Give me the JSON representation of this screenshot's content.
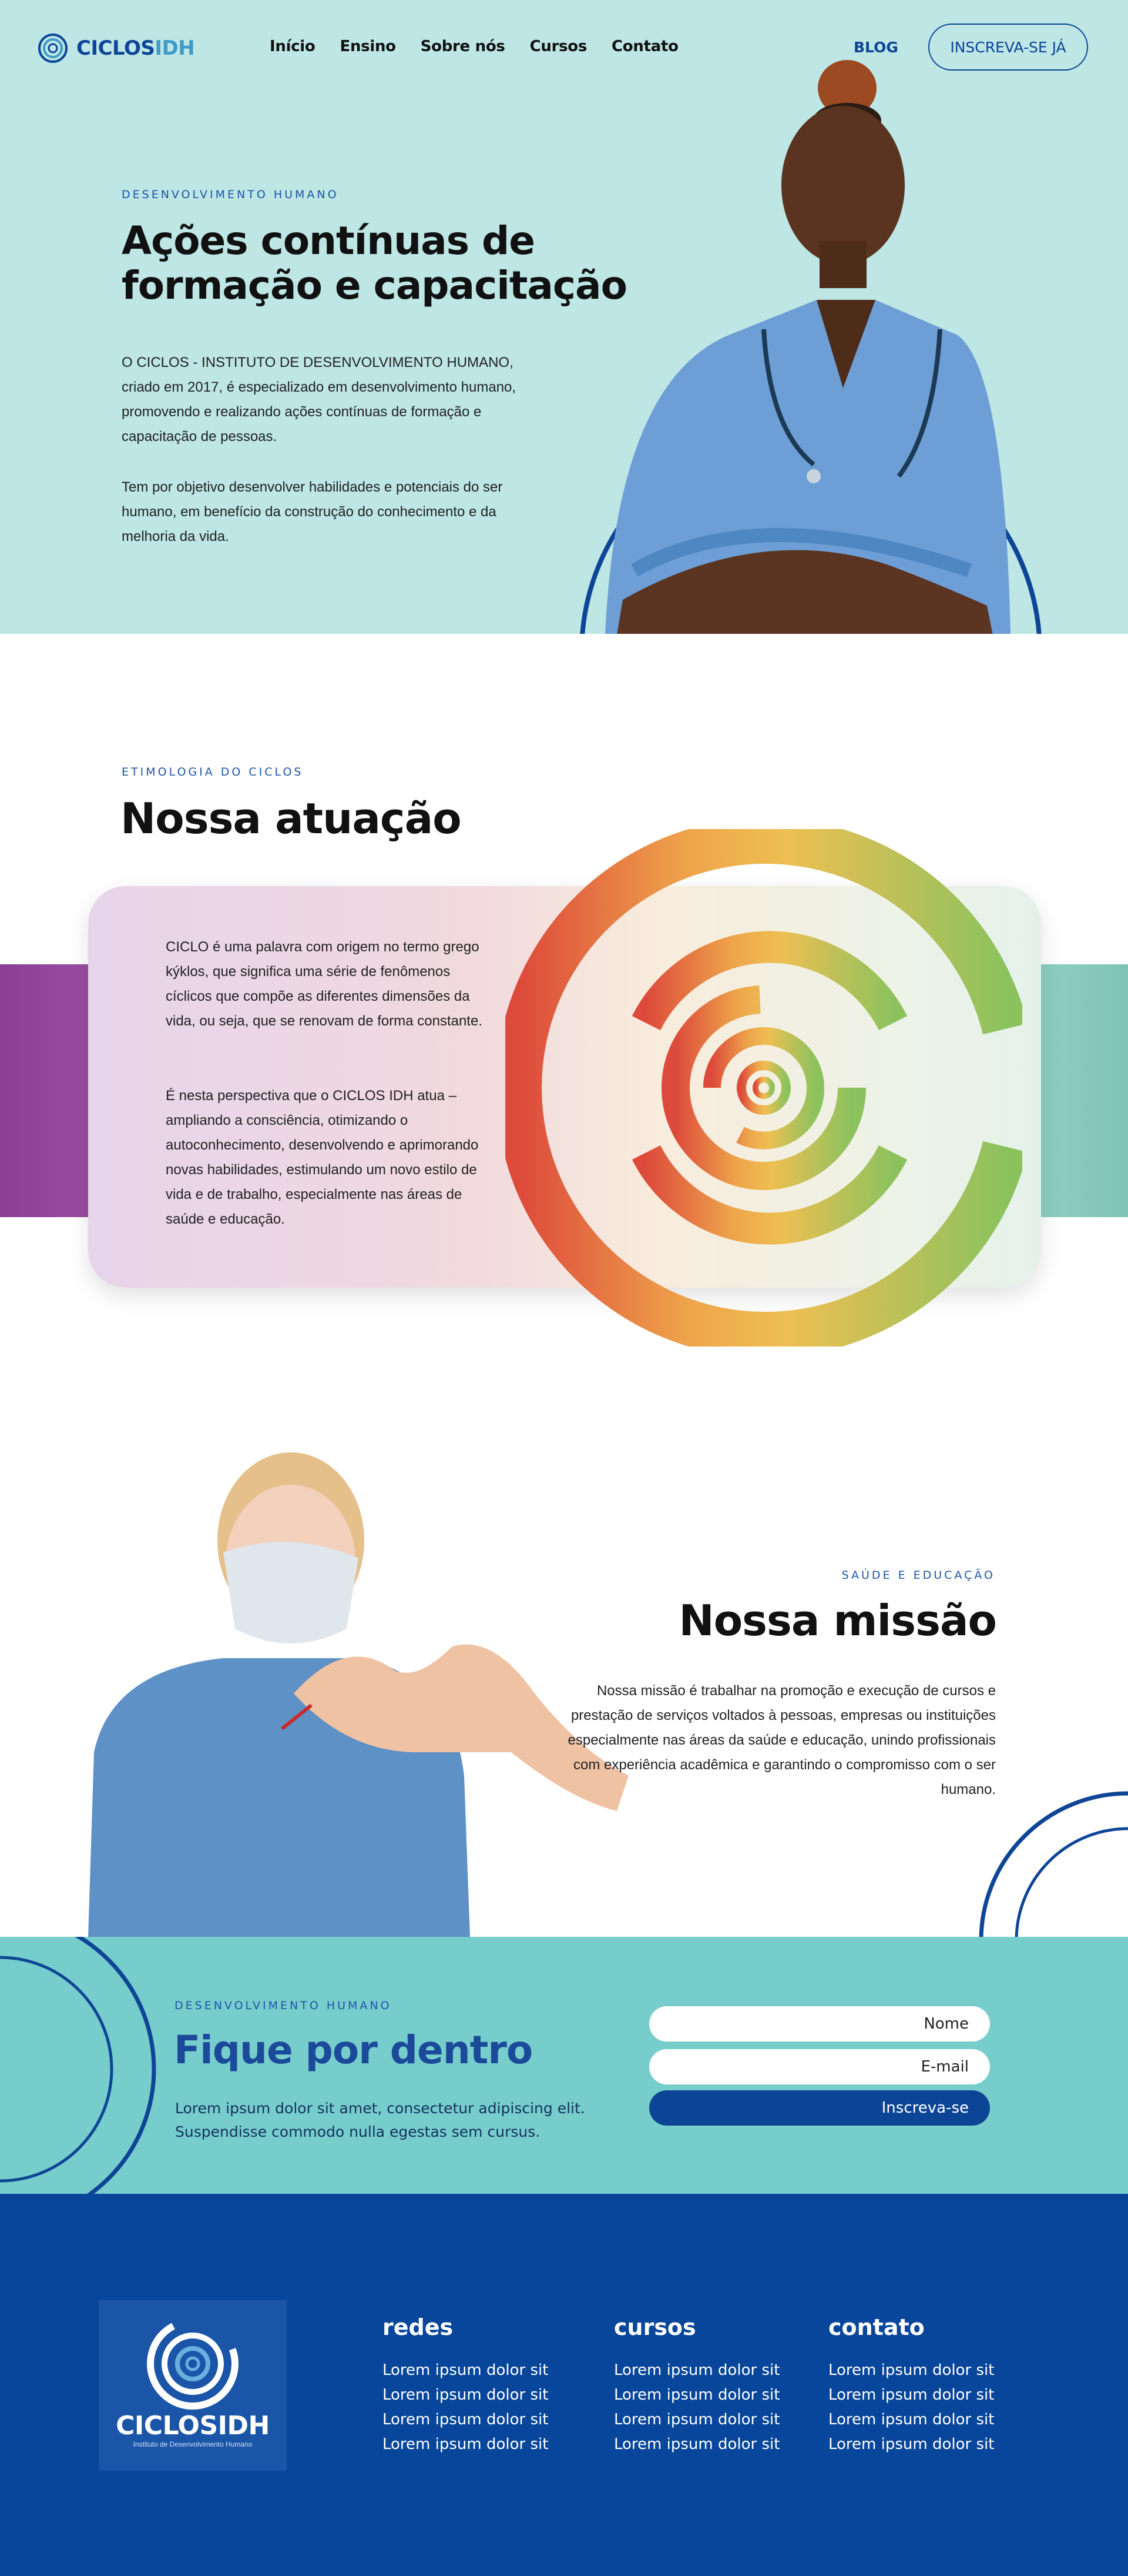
{
  "header": {
    "brand_main": "CICLOS",
    "brand_accent": "IDH",
    "nav": [
      "Início",
      "Ensino",
      "Sobre nós",
      "Cursos",
      "Contato"
    ],
    "blog": "BLOG",
    "cta": "INSCREVA-SE JÁ"
  },
  "hero": {
    "eyebrow": "DESENVOLVIMENTO HUMANO",
    "title": "Ações contínuas de formação e capacitação",
    "paragraph1": "O CICLOS - INSTITUTO DE DESENVOLVIMENTO HUMANO, criado em 2017, é especializado em desenvolvimento humano, promovendo e realizando ações contínuas de formação e capacitação de pessoas.",
    "paragraph2": "Tem por objetivo desenvolver habilidades e potenciais do ser humano, em benefício da construção do conhecimento e da melhoria da vida."
  },
  "atuacao": {
    "eyebrow": "ETIMOLOGIA DO CICLOS",
    "title": "Nossa atuação",
    "paragraph1": "CICLO é uma palavra com origem no termo grego kýklos, que significa uma série de fenômenos cíclicos que compõe as diferentes dimensões da vida, ou seja, que se renovam de forma constante.",
    "paragraph2": "É nesta perspectiva que o CICLOS IDH  atua – ampliando a consciência, otimizando o autoconhecimento, desenvolvendo e aprimorando novas habilidades, estimulando um novo estilo de vida e de trabalho, especialmente nas áreas de saúde e educação."
  },
  "missao": {
    "eyebrow": "SAÚDE E EDUCAÇÃO",
    "title": "Nossa missão",
    "paragraph": "Nossa missão é trabalhar na promoção e execução de cursos e prestação de serviços voltados à pessoas, empresas ou instituições especialmente nas áreas da saúde e educação, unindo profissionais com experiência acadêmica e garantindo o compromisso com o ser humano."
  },
  "newsletter": {
    "eyebrow": "DESENVOLVIMENTO HUMANO",
    "title": "Fique por dentro",
    "text": "Lorem ipsum dolor sit amet, consectetur adipiscing elit. Suspendisse commodo nulla egestas sem cursus.",
    "name_placeholder": "Nome",
    "email_placeholder": "E-mail",
    "button": "Inscreva-se"
  },
  "footer": {
    "brand": "CICLOSIDH",
    "brand_sub": "Instituto de Desenvolvimento Humano",
    "columns": [
      {
        "title": "redes",
        "items": [
          "Lorem ipsum dolor sit",
          "Lorem ipsum dolor sit",
          "Lorem ipsum dolor sit",
          "Lorem ipsum dolor sit"
        ]
      },
      {
        "title": "cursos",
        "items": [
          "Lorem ipsum dolor sit",
          "Lorem ipsum dolor sit",
          "Lorem ipsum dolor sit",
          "Lorem ipsum dolor sit"
        ]
      },
      {
        "title": "contato",
        "items": [
          "Lorem ipsum dolor sit",
          "Lorem ipsum dolor sit",
          "Lorem ipsum dolor sit",
          "Lorem ipsum dolor sit"
        ]
      }
    ]
  },
  "colors": {
    "hero_bg": "#bde6e5",
    "primary_blue": "#0e4596",
    "newsletter_bg": "#77cdcb",
    "footer_bg": "#07469a"
  },
  "icons": [
    "ciclos-logo-icon",
    "cycle-rings-graphic",
    "decorative-arcs"
  ]
}
